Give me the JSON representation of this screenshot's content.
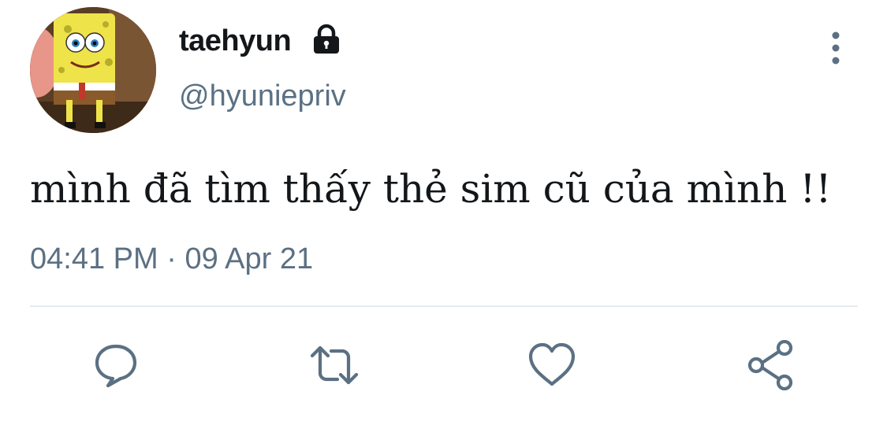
{
  "tweet": {
    "display_name": "taehyun",
    "handle": "@hyuniepriv",
    "text": "mình đã tìm thấy thẻ sim cũ của mình !!",
    "time": "04:41 PM",
    "separator": "·",
    "date": "09 Apr 21"
  },
  "icons": {
    "lock": "lock-icon",
    "more": "more-vertical-icon",
    "reply": "reply-icon",
    "retweet": "retweet-icon",
    "like": "heart-icon",
    "share": "share-icon"
  },
  "colors": {
    "text": "#14171a",
    "secondary": "#5b7083",
    "divider": "#e6ecf0",
    "icon": "#5b7083"
  }
}
